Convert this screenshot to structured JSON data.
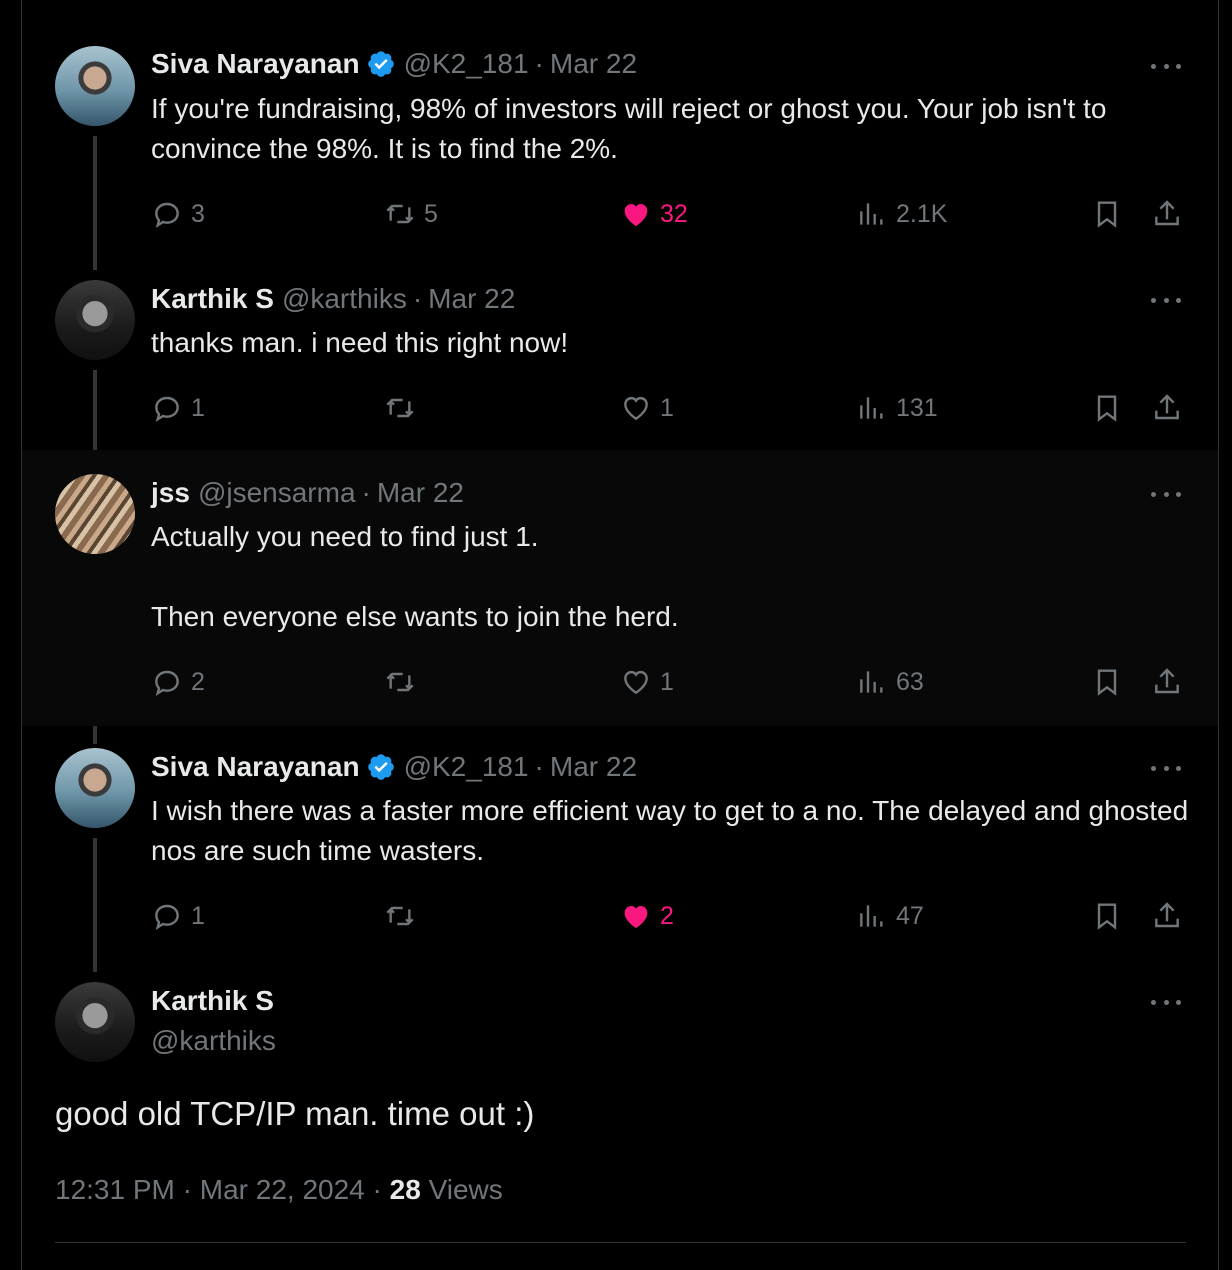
{
  "colors": {
    "background": "#000000",
    "text": "#e7e9ea",
    "muted": "#71767b",
    "like": "#f91880",
    "verified": "#1d9bf0"
  },
  "tweets": [
    {
      "name": "Siva Narayanan",
      "verified": true,
      "handle": "@K2_181",
      "date": "Mar 22",
      "text": "If you're fundraising, 98% of investors will reject or ghost you. Your job isn't to convince the 98%. It is to find the 2%.",
      "replies": "3",
      "retweets": "5",
      "likes": "32",
      "liked": true,
      "views": "2.1K"
    },
    {
      "name": "Karthik S",
      "verified": false,
      "handle": "@karthiks",
      "date": "Mar 22",
      "text": "thanks man. i need this right now!",
      "replies": "1",
      "retweets": "",
      "likes": "1",
      "liked": false,
      "views": "131"
    },
    {
      "name": "jss",
      "verified": false,
      "handle": "@jsensarma",
      "date": "Mar 22",
      "text_line1": "Actually you need to find just 1.",
      "text_line2": "Then everyone else wants to join the herd.",
      "replies": "2",
      "retweets": "",
      "likes": "1",
      "liked": false,
      "views": "63"
    },
    {
      "name": "Siva Narayanan",
      "verified": true,
      "handle": "@K2_181",
      "date": "Mar 22",
      "text": "I wish there was a faster more efficient way to get to a no. The delayed and ghosted nos are such time wasters.",
      "replies": "1",
      "retweets": "",
      "likes": "2",
      "liked": true,
      "views": "47"
    }
  ],
  "main": {
    "name": "Karthik S",
    "handle": "@karthiks",
    "text": "good old TCP/IP man. time out :)",
    "time": "12:31 PM",
    "date": "Mar 22, 2024",
    "views_count": "28",
    "views_label": "Views"
  },
  "separator": "·",
  "icons": [
    "reply-icon",
    "retweet-icon",
    "like-icon",
    "views-icon",
    "bookmark-icon",
    "share-icon",
    "more-icon",
    "verified-icon"
  ]
}
